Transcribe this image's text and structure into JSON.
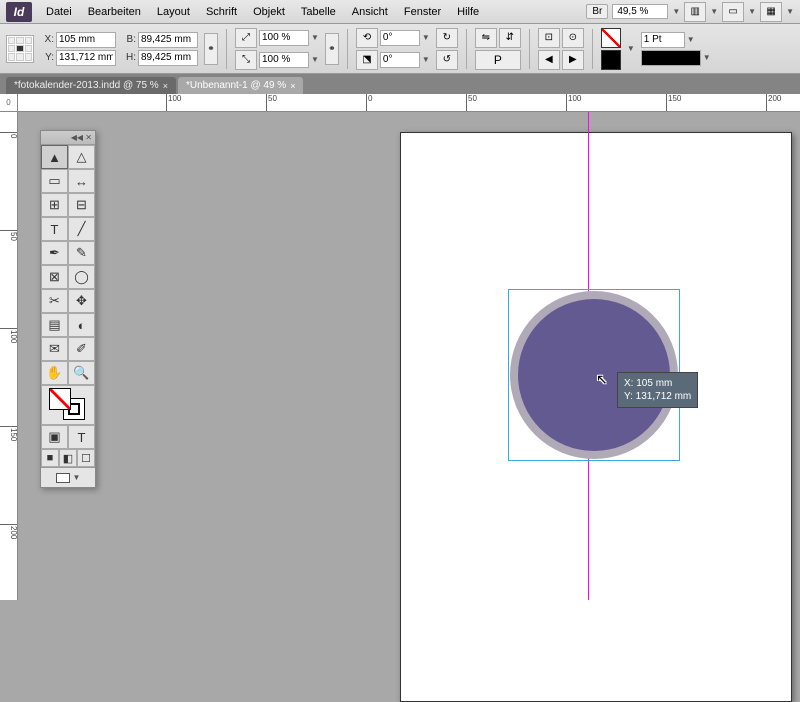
{
  "menu": {
    "items": [
      "Datei",
      "Bearbeiten",
      "Layout",
      "Schrift",
      "Objekt",
      "Tabelle",
      "Ansicht",
      "Fenster",
      "Hilfe"
    ],
    "br_label": "Br",
    "zoom": "49,5 %"
  },
  "control": {
    "x_label": "X:",
    "x": "105 mm",
    "y_label": "Y:",
    "y": "131,712 mm",
    "w_label": "B:",
    "w": "89,425 mm",
    "h_label": "H:",
    "h": "89,425 mm",
    "scale_x": "100 %",
    "scale_y": "100 %",
    "rot": "0°",
    "shear": "0°",
    "stroke_weight": "1 Pt"
  },
  "tabs": [
    {
      "label": "*fotokalender-2013.indd @ 75 %",
      "active": false
    },
    {
      "label": "*Unbenannt-1 @ 49 %",
      "active": true
    }
  ],
  "ruler_h": [
    {
      "pos": 148,
      "label": "100"
    },
    {
      "pos": 248,
      "label": "50"
    },
    {
      "pos": 348,
      "label": "0"
    },
    {
      "pos": 448,
      "label": "50"
    },
    {
      "pos": 548,
      "label": "100"
    },
    {
      "pos": 648,
      "label": "150"
    },
    {
      "pos": 748,
      "label": "200"
    }
  ],
  "ruler_v": [
    {
      "pos": 20,
      "label": "0"
    },
    {
      "pos": 118,
      "label": "50"
    },
    {
      "pos": 216,
      "label": "100"
    },
    {
      "pos": 314,
      "label": "150"
    },
    {
      "pos": 412,
      "label": "200"
    }
  ],
  "tooltip": {
    "line1": "X: 105 mm",
    "line2": "Y: 131,712 mm"
  },
  "tools": {
    "row1": [
      "selection-tool",
      "direct-selection-tool"
    ],
    "row2": [
      "page-tool",
      "gap-tool"
    ],
    "row3": [
      "content-collector",
      "content-placer"
    ],
    "row4": [
      "type-tool",
      "line-tool"
    ],
    "row5": [
      "pen-tool",
      "pencil-tool"
    ],
    "row6": [
      "rectangle-frame-tool",
      "ellipse-tool"
    ],
    "row7": [
      "scissors-tool",
      "free-transform-tool"
    ],
    "row8": [
      "gradient-swatch-tool",
      "gradient-feather-tool"
    ],
    "row9": [
      "note-tool",
      "eyedropper-tool"
    ],
    "row10": [
      "hand-tool",
      "zoom-tool"
    ],
    "bottom": [
      "normal-mode",
      "preview-mode"
    ],
    "color_row": [
      "apply-color",
      "apply-gradient",
      "apply-none"
    ]
  },
  "glyphs": {
    "sel": "▲",
    "dsel": "△",
    "page": "▭",
    "gap": "↔",
    "cc": "⊞",
    "cp": "⊟",
    "type": "T",
    "line": "╱",
    "pen": "✒",
    "pencil": "✎",
    "rect": "⊠",
    "ellipse": "◯",
    "scis": "✂",
    "xform": "✥",
    "grad": "▤",
    "gfeath": "◐",
    "note": "✉",
    "eye": "✐",
    "hand": "✋",
    "zoom": "🔍",
    "normal": "▣",
    "preview": "T",
    "color": "■",
    "gradsw": "◧",
    "none": "☐"
  }
}
